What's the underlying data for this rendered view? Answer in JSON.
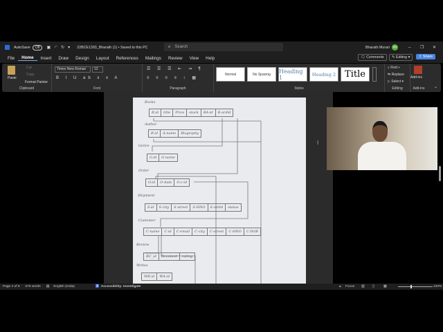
{
  "titlebar": {
    "autosave": "AutoSave",
    "toggle": "Off",
    "doc_title": "22BCE1393_Bharath (1) • Saved to this PC",
    "search_placeholder": "Search",
    "user": "Bharath Murari",
    "initials": "BM"
  },
  "menu": [
    "File",
    "Home",
    "Insert",
    "Draw",
    "Design",
    "Layout",
    "References",
    "Mailings",
    "Review",
    "View",
    "Help"
  ],
  "actions": {
    "comments": "Comments",
    "editing": "Editing",
    "share": "Share"
  },
  "ribbon": {
    "clipboard": {
      "paste": "Paste",
      "cut": "Cut",
      "copy": "Copy",
      "format_painter": "Format Painter",
      "label": "Clipboard"
    },
    "font": {
      "name": "Times New Roman",
      "size": "12",
      "label": "Font"
    },
    "paragraph": {
      "label": "Paragraph"
    },
    "styles": {
      "items": [
        "Normal",
        "No Spacing",
        "Heading 1",
        "Heading 2",
        "Title"
      ],
      "label": "Styles"
    },
    "editing": {
      "find": "Find",
      "replace": "Replace",
      "select": "Select",
      "label": "Editing"
    },
    "addins": {
      "button": "Add-ins",
      "label": "Add-ins"
    }
  },
  "diagram": {
    "tables": [
      {
        "name": "Books",
        "cols": [
          "B.id",
          "title",
          "Price",
          "stock",
          "BA-id",
          "B-ordid"
        ]
      },
      {
        "name": "Author",
        "cols": [
          "B.id",
          "A.name",
          "Biography"
        ]
      },
      {
        "name": "Genre",
        "cols": [
          "G.id",
          "G-name"
        ]
      },
      {
        "name": "Order",
        "cols": [
          "O.id",
          "O-date",
          "O.c-id"
        ]
      },
      {
        "name": "Shipment",
        "cols": [
          "S.id",
          "S-city",
          "S-street",
          "S-HNO",
          "S-ordid",
          "status"
        ]
      },
      {
        "name": "Customer",
        "cols": [
          "C-name",
          "C-id",
          "C-email",
          "C-city",
          "C-street",
          "C-HNO",
          "C-DOB"
        ]
      },
      {
        "name": "Review",
        "cols": [
          "RC_id",
          "Rcontent",
          "rating"
        ]
      },
      {
        "name": "Writes",
        "cols": [
          "WB.id",
          "WA.id"
        ]
      }
    ]
  },
  "status": {
    "page": "Page 4 of 8",
    "words": "675 words",
    "language": "English (India)",
    "accessibility": "Accessibility: Investigate",
    "focus": "Focus",
    "zoom": "100%"
  }
}
